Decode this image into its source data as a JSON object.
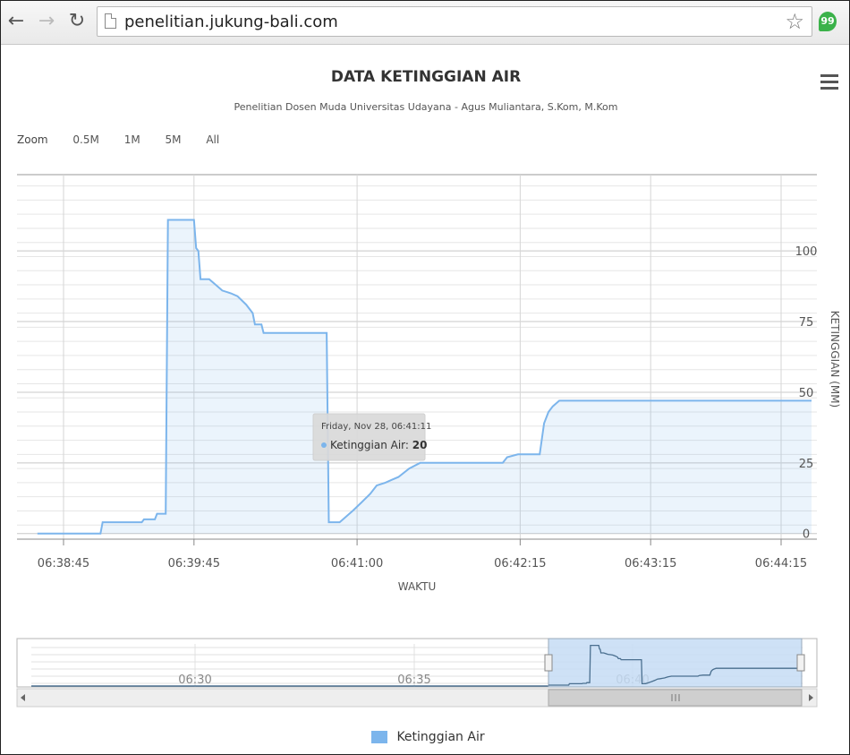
{
  "browser": {
    "url": "penelitian.jukung-bali.com"
  },
  "chart_title": "DATA KETINGGIAN AIR",
  "chart_subtitle": "Penelitian Dosen Muda Universitas Udayana - Agus Muliantara, S.Kom, M.Kom",
  "zoom": {
    "label": "Zoom",
    "buttons": [
      "0.5M",
      "1M",
      "5M",
      "All"
    ]
  },
  "chart_data": {
    "type": "area",
    "title": "DATA KETINGGIAN AIR",
    "subtitle": "Penelitian Dosen Muda Universitas Udayana - Agus Muliantara, S.Kom, M.Kom",
    "xlabel": "WAKTU",
    "ylabel": "KETINGGIAN (MM)",
    "x_ticks": [
      "06:38:45",
      "06:39:45",
      "06:41:00",
      "06:42:15",
      "06:43:15",
      "06:44:15"
    ],
    "y_ticks": [
      0,
      25,
      50,
      75,
      100
    ],
    "ylim": [
      -2,
      127
    ],
    "grid": true,
    "legend_position": "bottom-center",
    "color": "#7cb5ec",
    "series": [
      {
        "name": "Ketinggian Air",
        "points": [
          [
            "06:38:33",
            0
          ],
          [
            "06:39:02",
            0
          ],
          [
            "06:39:03",
            4
          ],
          [
            "06:39:21",
            4
          ],
          [
            "06:39:22",
            5
          ],
          [
            "06:39:27",
            5
          ],
          [
            "06:39:28",
            7
          ],
          [
            "06:39:32",
            7
          ],
          [
            "06:39:33",
            111
          ],
          [
            "06:39:45",
            111
          ],
          [
            "06:39:46",
            101
          ],
          [
            "06:39:47",
            100
          ],
          [
            "06:39:48",
            90
          ],
          [
            "06:39:52",
            90
          ],
          [
            "06:39:55",
            88
          ],
          [
            "06:39:58",
            86
          ],
          [
            "06:40:02",
            85
          ],
          [
            "06:40:05",
            84
          ],
          [
            "06:40:09",
            81
          ],
          [
            "06:40:12",
            78
          ],
          [
            "06:40:13",
            74
          ],
          [
            "06:40:16",
            74
          ],
          [
            "06:40:17",
            71
          ],
          [
            "06:40:46",
            71
          ],
          [
            "06:40:47",
            4
          ],
          [
            "06:40:52",
            4
          ],
          [
            "06:40:55",
            6
          ],
          [
            "06:40:58",
            8
          ],
          [
            "06:41:02",
            11
          ],
          [
            "06:41:06",
            14
          ],
          [
            "06:41:09",
            17
          ],
          [
            "06:41:13",
            18
          ],
          [
            "06:41:16",
            19
          ],
          [
            "06:41:19",
            20
          ],
          [
            "06:41:24",
            23
          ],
          [
            "06:41:29",
            25
          ],
          [
            "06:42:07",
            25
          ],
          [
            "06:42:09",
            27
          ],
          [
            "06:42:14",
            28
          ],
          [
            "06:42:24",
            28
          ],
          [
            "06:42:26",
            39
          ],
          [
            "06:42:28",
            43
          ],
          [
            "06:42:30",
            45
          ],
          [
            "06:42:33",
            47
          ],
          [
            "06:44:29",
            47
          ]
        ]
      }
    ],
    "tooltip": {
      "date": "Friday, Nov 28, 06:41:11",
      "series": "Ketinggian Air",
      "value": 20
    },
    "navigator": {
      "ticks": [
        "06:30",
        "06:35",
        "06:40"
      ]
    }
  },
  "legend": {
    "label": "Ketinggian Air",
    "color": "#7cb5ec"
  }
}
